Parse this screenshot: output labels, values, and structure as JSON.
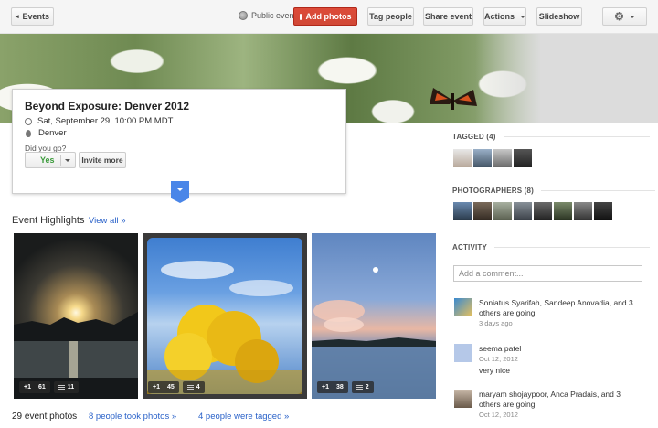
{
  "toolbar": {
    "events_label": "Events",
    "public_label": "Public event",
    "add_photos_label": "Add photos",
    "tag_people_label": "Tag people",
    "share_event_label": "Share event",
    "actions_label": "Actions",
    "slideshow_label": "Slideshow"
  },
  "event": {
    "title": "Beyond Exposure: Denver 2012",
    "datetime": "Sat, September 29, 10:00 PM MDT",
    "location": "Denver",
    "rsvp_question": "Did you go?",
    "rsvp_value": "Yes",
    "invite_label": "Invite more"
  },
  "highlights": {
    "title": "Event Highlights",
    "view_all": "View all »",
    "tiles": [
      {
        "plus": "+1",
        "plus_count": "61",
        "comments": "11"
      },
      {
        "plus": "+1",
        "plus_count": "45",
        "comments": "4"
      },
      {
        "plus": "+1",
        "plus_count": "38",
        "comments": "2"
      }
    ]
  },
  "footer": {
    "photo_count": "29 event photos",
    "took_photos": "8 people took photos »",
    "were_tagged": "4 people were tagged »"
  },
  "sidebar": {
    "tagged_title": "TAGGED (4)",
    "photographers_title": "PHOTOGRAPHERS (8)",
    "activity_title": "ACTIVITY",
    "comment_placeholder": "Add a comment...",
    "activity": [
      {
        "text": "Soniatus Syarifah, Sandeep Anovadia, and 3 others are going",
        "time": "3 days ago"
      },
      {
        "name": "seema patel",
        "time": "Oct 12, 2012",
        "text": "very nice"
      },
      {
        "text": "maryam shojaypoor, Anca Pradais, and 3 others are going",
        "time": "Oct 12, 2012"
      }
    ]
  },
  "colors": {
    "accent_red": "#d14836",
    "link_blue": "#2a62c9",
    "rsvp_green": "#3a9a3a",
    "expand_blue": "#4a86e8"
  }
}
